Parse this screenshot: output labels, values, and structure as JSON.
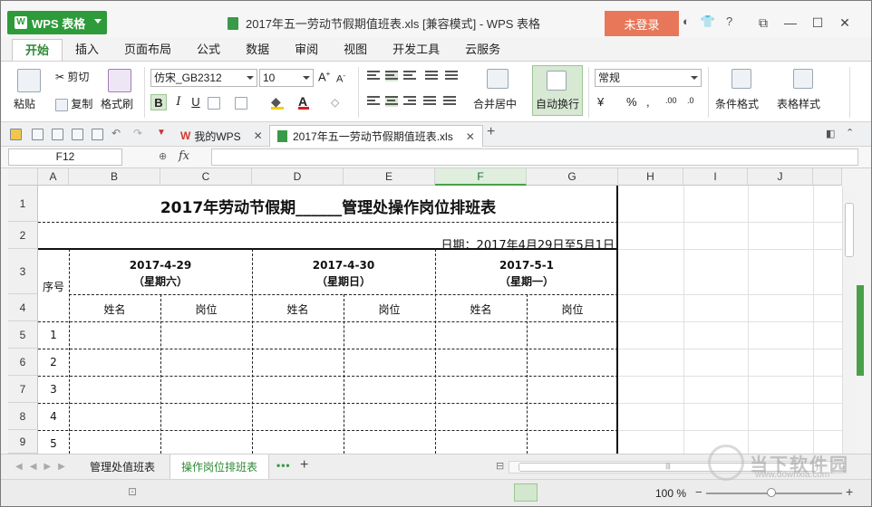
{
  "app": {
    "name": "WPS 表格",
    "window_title": "2017年五一劳动节假期值班表.xls [兼容模式] - WPS 表格",
    "login_label": "未登录",
    "brand_green": "#2d9b3a",
    "login_color": "#e8775a"
  },
  "ribbon_tabs": [
    "开始",
    "插入",
    "页面布局",
    "公式",
    "数据",
    "审阅",
    "视图",
    "开发工具",
    "云服务"
  ],
  "ribbon": {
    "paste": "粘贴",
    "cut": "剪切",
    "copy": "复制",
    "format_painter": "格式刷",
    "font_name": "仿宋_GB2312",
    "font_size": "10",
    "bold": "B",
    "italic": "I",
    "underline": "U",
    "merge_center": "合并居中",
    "wrap_text": "自动换行",
    "number_format": "常规",
    "conditional_format": "条件格式",
    "table_style": "表格样式"
  },
  "doc_tabs": [
    {
      "label": "我的WPS"
    },
    {
      "label": "2017年五一劳动节假期值班表.xls"
    }
  ],
  "formula_bar": {
    "cell_ref": "F12",
    "fx": "fx",
    "content": ""
  },
  "columns": [
    "A",
    "B",
    "C",
    "D",
    "E",
    "F",
    "G",
    "H",
    "I",
    "J"
  ],
  "selected_column": "F",
  "rows": [
    "1",
    "2",
    "3",
    "4",
    "5",
    "6",
    "7",
    "8",
    "9"
  ],
  "sheet": {
    "title": "2017年劳动节假期______管理处操作岗位排班表",
    "date_line": "日期：2017年4月29日至5月1日",
    "seq_header": "序号",
    "days": [
      {
        "date": "2017-4-29",
        "weekday": "（星期六）"
      },
      {
        "date": "2017-4-30",
        "weekday": "（星期日）"
      },
      {
        "date": "2017-5-1",
        "weekday": "（星期一）"
      }
    ],
    "sub_headers": [
      "姓名",
      "岗位",
      "姓名",
      "岗位",
      "姓名",
      "岗位"
    ],
    "row_numbers": [
      "1",
      "2",
      "3",
      "4",
      "5"
    ]
  },
  "sheet_tabs": [
    {
      "label": "管理处值班表",
      "active": false
    },
    {
      "label": "操作岗位排班表",
      "active": true
    }
  ],
  "status": {
    "zoom": "100 %",
    "zoom_fraction": 0.48
  },
  "watermark": {
    "text": "当下软件园",
    "url": "www.downxia.com"
  }
}
